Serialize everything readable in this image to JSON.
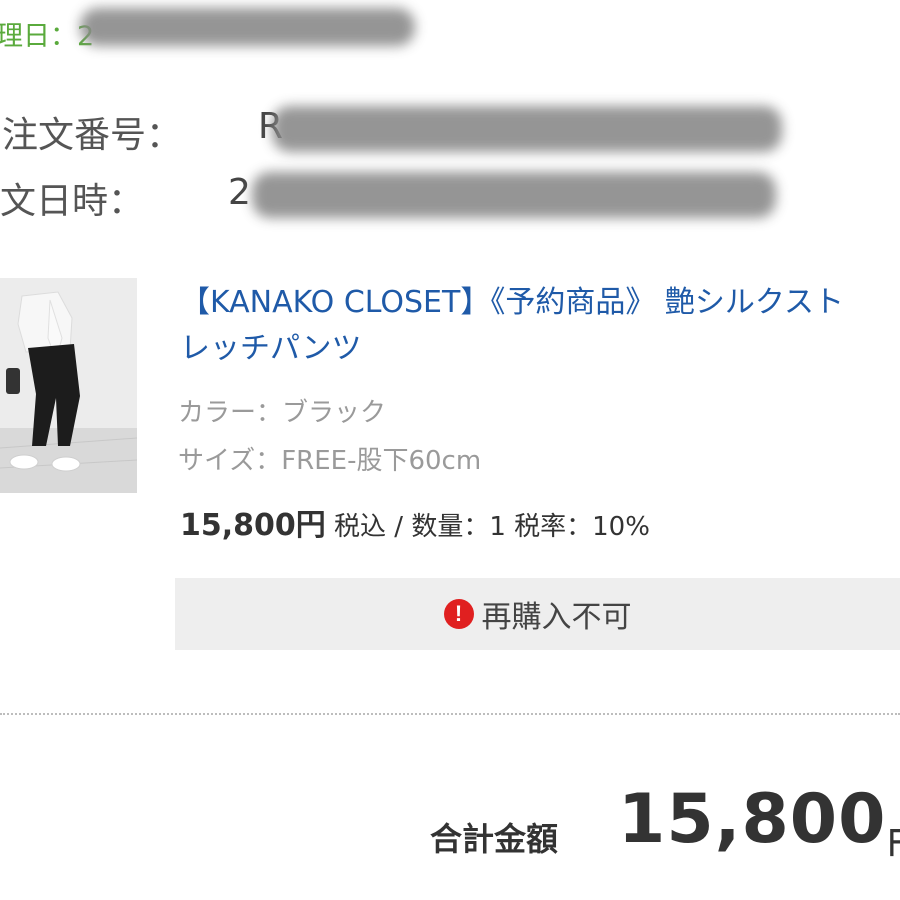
{
  "header": {
    "processed_date_label": "理日：",
    "processed_date_value": "2",
    "processed_date_redacted": true
  },
  "order": {
    "number_label": "注文番号：",
    "number_value": "R",
    "date_label": "文日時：",
    "date_value": "2"
  },
  "product": {
    "title_line1": "【KANAKO CLOSET】《予約商品》 艶シルクスト",
    "title_line2": "レッチパンツ",
    "color_attr": "カラー：ブラック",
    "size_attr": "サイズ：FREE-股下60cm",
    "price": "15,800円",
    "price_detail": " 税込 / 数量：1 税率：10%",
    "thumbnail_icon": "product-photo"
  },
  "rebuy": {
    "icon": "alert-icon",
    "icon_glyph": "!",
    "label": "再購入不可",
    "icon_color": "#e02020"
  },
  "summary": {
    "total_label": "合計金額",
    "total_value": "15,800",
    "total_unit": "円"
  },
  "colors": {
    "link": "#1f5aa8",
    "status_green": "#5aaa3c",
    "muted": "#9a9a9a",
    "box_bg": "#eeeeee"
  }
}
